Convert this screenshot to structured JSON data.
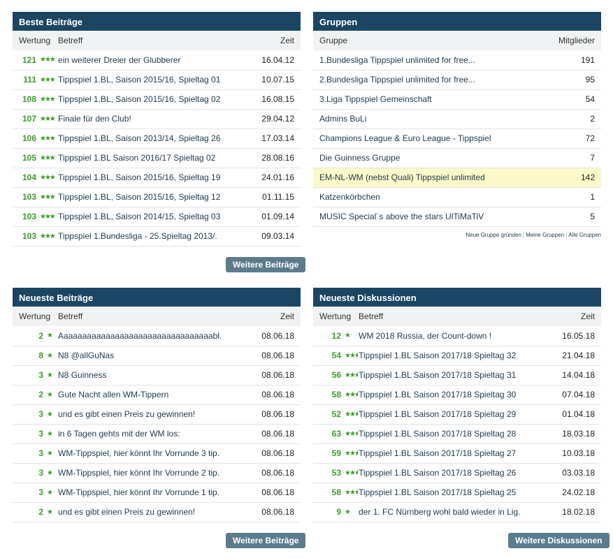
{
  "best_posts": {
    "title": "Beste Beiträge",
    "columns": [
      "Wertung",
      "Betreff",
      "Zeit"
    ],
    "rows": [
      {
        "score": "121",
        "stars": "★★★",
        "title": "ein weiterer Dreier der Glubberer",
        "time": "16.04.12"
      },
      {
        "score": "111",
        "stars": "★★★",
        "title": "Tippspiel 1.BL, Saison 2015/16, Spieltag 01",
        "time": "10.07.15"
      },
      {
        "score": "108",
        "stars": "★★★",
        "title": "Tippspiel 1.BL, Saison 2015/16, Spieltag 02",
        "time": "16.08.15"
      },
      {
        "score": "107",
        "stars": "★★★",
        "title": "Finale für den Club!",
        "time": "29.04.12"
      },
      {
        "score": "106",
        "stars": "★★★",
        "title": "Tippspiel 1.BL, Saison 2013/14, Spieltag 26",
        "time": "17.03.14"
      },
      {
        "score": "105",
        "stars": "★★★",
        "title": "Tippspiel 1.BL Saison 2016/17 Spieltag 02",
        "time": "28.08.16"
      },
      {
        "score": "104",
        "stars": "★★★",
        "title": "Tippspiel 1.BL, Saison 2015/16, Spieltag 19",
        "time": "24.01.16"
      },
      {
        "score": "103",
        "stars": "★★★",
        "title": "Tippspiel 1.BL, Saison 2015/16, Spieltag 12",
        "time": "01.11.15"
      },
      {
        "score": "103",
        "stars": "★★★",
        "title": "Tippspiel 1.BL, Saison 2014/15, Spieltag 03",
        "time": "01.09.14"
      },
      {
        "score": "103",
        "stars": "★★★",
        "title": "Tippspiel 1.Bundesliga - 25.Spieltag 2013/.",
        "time": "09.03.14"
      }
    ],
    "more_button": "Weitere Beiträge"
  },
  "groups": {
    "title": "Gruppen",
    "columns": [
      "Gruppe",
      "Mitglieder"
    ],
    "rows": [
      {
        "name": "1.Bundesliga Tippspiel unlimited for free...",
        "members": "191"
      },
      {
        "name": "2.Bundesliga Tippspiel unlimited for free...",
        "members": "95"
      },
      {
        "name": "3.Liga Tippspiel Gemeinschaft",
        "members": "54"
      },
      {
        "name": "Admins BuLi",
        "members": "2"
      },
      {
        "name": "Champions League & Euro League - Tippspiel",
        "members": "72"
      },
      {
        "name": "Die Guinness Gruppe",
        "members": "7"
      },
      {
        "name": "EM-NL-WM (nebst Quali) Tippspiel unlimited",
        "members": "142"
      },
      {
        "name": "Katzenkörbchen",
        "members": "1"
      },
      {
        "name": "MUSIC Special´s above the stars UlTiMaTiV",
        "members": "5"
      }
    ],
    "links": [
      "Neue Gruppe gründen",
      "Meine Gruppen",
      "Alle Gruppen"
    ]
  },
  "newest_posts": {
    "title": "Neueste Beiträge",
    "columns": [
      "Wertung",
      "Betreff",
      "Zeit"
    ],
    "rows": [
      {
        "score": "2",
        "stars": "★",
        "title": "Aaaaaaaaaaaaaaaaaaaaaaaaaaaaaaaaabl.",
        "time": "08.06.18"
      },
      {
        "score": "8",
        "stars": "★",
        "title": "N8 @allGuNas",
        "time": "08.06.18"
      },
      {
        "score": "3",
        "stars": "★",
        "title": "N8 Guinness",
        "time": "08.06.18"
      },
      {
        "score": "2",
        "stars": "★",
        "title": "Gute Nacht allen WM-Tippern",
        "time": "08.06.18"
      },
      {
        "score": "3",
        "stars": "★",
        "title": "und es gibt einen Preis zu gewinnen!",
        "time": "08.06.18"
      },
      {
        "score": "3",
        "stars": "★",
        "title": "in 6 Tagen gehts mit der WM los:",
        "time": "08.06.18"
      },
      {
        "score": "3",
        "stars": "★",
        "title": "WM-Tippspiel, hier könnt Ihr Vorrunde 3 tip.",
        "time": "08.06.18"
      },
      {
        "score": "3",
        "stars": "★",
        "title": "WM-Tippspiel, hier könnt Ihr Vorrunde 2 tip.",
        "time": "08.06.18"
      },
      {
        "score": "3",
        "stars": "★",
        "title": "WM-Tippspiel, hier könnt Ihr Vorrunde 1 tip.",
        "time": "08.06.18"
      },
      {
        "score": "2",
        "stars": "★",
        "title": "und es gibt einen Preis zu gewinnen!",
        "time": "08.06.18"
      }
    ],
    "more_button": "Weitere Beiträge"
  },
  "newest_discussions": {
    "title": "Neueste Diskussionen",
    "columns": [
      "Wertung",
      "Betreff",
      "Zeit"
    ],
    "rows": [
      {
        "score": "12",
        "stars": "★",
        "title": "WM 2018 Russia, der Count-down !",
        "time": "16.05.18"
      },
      {
        "score": "54",
        "stars": "★★★",
        "title": "Tippspiel 1.BL Saison 2017/18 Spieltag 32",
        "time": "21.04.18"
      },
      {
        "score": "56",
        "stars": "★★★",
        "title": "Tippspiel 1.BL Saison 2017/18 Spieltag 31",
        "time": "14.04.18"
      },
      {
        "score": "58",
        "stars": "★★★",
        "title": "Tippspiel 1.BL Saison 2017/18 Spieltag 30",
        "time": "07.04.18"
      },
      {
        "score": "52",
        "stars": "★★★",
        "title": "Tippspiel 1.BL Saison 2017/18 Spieltag 29",
        "time": "01.04.18"
      },
      {
        "score": "63",
        "stars": "★★★",
        "title": "Tippspiel 1.BL Saison 2017/18 Spieltag 28",
        "time": "18.03.18"
      },
      {
        "score": "59",
        "stars": "★★★",
        "title": "Tippspiel 1.BL Saison 2017/18 Spieltag 27",
        "time": "10.03.18"
      },
      {
        "score": "53",
        "stars": "★★★",
        "title": "Tippspiel 1.BL Saison 2017/18 Spieltag 26",
        "time": "03.03.18"
      },
      {
        "score": "58",
        "stars": "★★★",
        "title": "Tippspiel 1.BL Saison 2017/18 Spieltag 25",
        "time": "24.02.18"
      },
      {
        "score": "9",
        "stars": "★",
        "title": "der 1. FC Nürnberg wohl bald wieder in Lig.",
        "time": "18.02.18"
      }
    ],
    "more_button": "Weitere Diskussionen"
  }
}
